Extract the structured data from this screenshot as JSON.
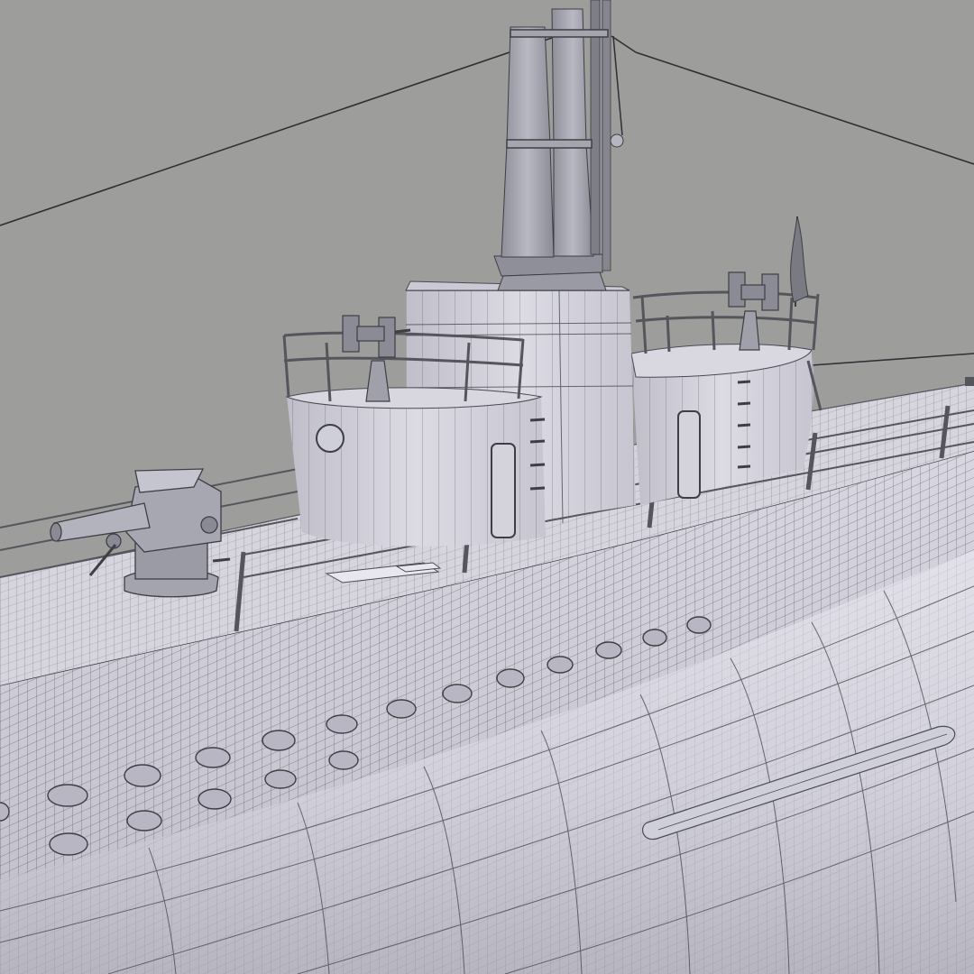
{
  "scene": {
    "subject": "submarine-wireframe-render",
    "colors": {
      "background": "#9d9d9b",
      "hull_light": "#e4e3ec",
      "hull_mid": "#cfcfda",
      "hull_dark": "#b2b2bd",
      "deck": "#d4d3dc",
      "wire": "#4a4a52",
      "rail": "#6d6d74"
    }
  }
}
